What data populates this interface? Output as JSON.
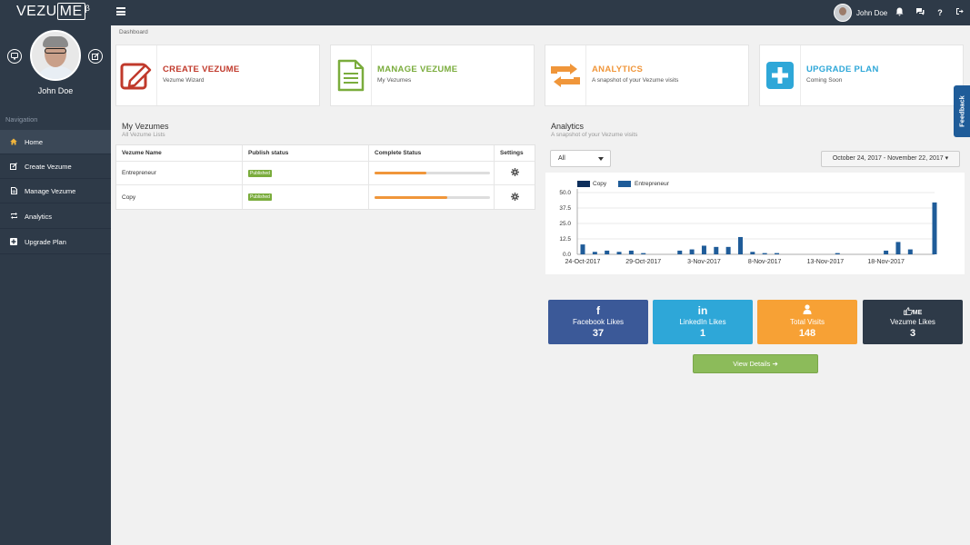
{
  "brand": {
    "logo_pre": "VEZU",
    "logo_me": "ME",
    "logo_sup": "β"
  },
  "topbar": {
    "user_name": "John Doe"
  },
  "sidebar": {
    "profile_name": "John Doe",
    "nav_label": "Navigation",
    "items": [
      {
        "label": "Home",
        "icon": "home-icon"
      },
      {
        "label": "Create Vezume",
        "icon": "edit-icon"
      },
      {
        "label": "Manage Vezume",
        "icon": "file-icon"
      },
      {
        "label": "Analytics",
        "icon": "retweet-icon"
      },
      {
        "label": "Upgrade Plan",
        "icon": "plus-square-icon"
      }
    ]
  },
  "breadcrumb": "Dashboard",
  "cards": [
    {
      "title": "CREATE VEZUME",
      "sub": "Vezume Wizard",
      "color": "#c0392b",
      "icon": "pencil-box-icon"
    },
    {
      "title": "MANAGE VEZUME",
      "sub": "My Vezumes",
      "color": "#7aac3c",
      "icon": "document-icon"
    },
    {
      "title": "ANALYTICS",
      "sub": "A snapshot of your Vezume visits",
      "color": "#f0963a",
      "icon": "retweet-icon"
    },
    {
      "title": "UPGRADE PLAN",
      "sub": "Coming Soon",
      "color": "#2ea7d8",
      "icon": "plus-icon"
    }
  ],
  "my_vezumes": {
    "title": "My Vezumes",
    "sub": "All Vezume Lists",
    "headers": [
      "Vezume Name",
      "Publish status",
      "Complete Status",
      "Settings"
    ],
    "rows": [
      {
        "name": "Entrepreneur",
        "status": "Published",
        "complete": 0.45
      },
      {
        "name": "Copy",
        "status": "Published",
        "complete": 0.63
      }
    ]
  },
  "analytics": {
    "title": "Analytics",
    "sub": "A snapshot of your Vezume visits",
    "filter_value": "All",
    "date_range": "October 24, 2017 - November 22, 2017"
  },
  "chart_data": {
    "type": "bar",
    "legend": [
      {
        "name": "Copy",
        "color": "#0e2f5c"
      },
      {
        "name": "Entrepreneur",
        "color": "#1f5c99"
      }
    ],
    "yticks": [
      "50.0",
      "37.5",
      "25.0",
      "12.5",
      "0.0"
    ],
    "ylim": [
      0,
      50
    ],
    "xticks": [
      "24-Oct-2017",
      "29-Oct-2017",
      "3-Nov-2017",
      "8-Nov-2017",
      "13-Nov-2017",
      "18-Nov-2017"
    ],
    "categories": [
      "24-Oct",
      "25-Oct",
      "26-Oct",
      "27-Oct",
      "28-Oct",
      "29-Oct",
      "30-Oct",
      "31-Oct",
      "1-Nov",
      "2-Nov",
      "3-Nov",
      "4-Nov",
      "5-Nov",
      "6-Nov",
      "7-Nov",
      "8-Nov",
      "9-Nov",
      "10-Nov",
      "11-Nov",
      "12-Nov",
      "13-Nov",
      "14-Nov",
      "15-Nov",
      "16-Nov",
      "17-Nov",
      "18-Nov",
      "19-Nov",
      "20-Nov",
      "21-Nov",
      "22-Nov"
    ],
    "series": [
      {
        "name": "Copy",
        "values": [
          0,
          0,
          0,
          0,
          0,
          0,
          0,
          0,
          0,
          0,
          0,
          0,
          0,
          0,
          0,
          0,
          0,
          0,
          0,
          0,
          0,
          0,
          0,
          0,
          0,
          0,
          0,
          0,
          0,
          0
        ]
      },
      {
        "name": "Entrepreneur",
        "values": [
          8,
          2,
          3,
          2,
          3,
          1,
          0,
          0,
          3,
          4,
          7,
          6,
          6,
          14,
          2,
          1,
          1,
          0,
          0,
          0,
          0,
          1,
          0,
          0,
          0,
          3,
          10,
          4,
          0,
          42
        ]
      }
    ]
  },
  "stats": [
    {
      "label": "Facebook Likes",
      "value": "37",
      "icon_text": "f",
      "color": "#3b5998"
    },
    {
      "label": "LinkedIn Likes",
      "value": "1",
      "icon_text": "in",
      "color": "#2ea7d8"
    },
    {
      "label": "Total Visits",
      "value": "148",
      "icon_text": "",
      "color": "#f7a135"
    },
    {
      "label": "Vezume Likes",
      "value": "3",
      "icon_text": "ME",
      "color": "#2e3a48"
    }
  ],
  "view_details": "View Details",
  "feedback": "Feedback"
}
